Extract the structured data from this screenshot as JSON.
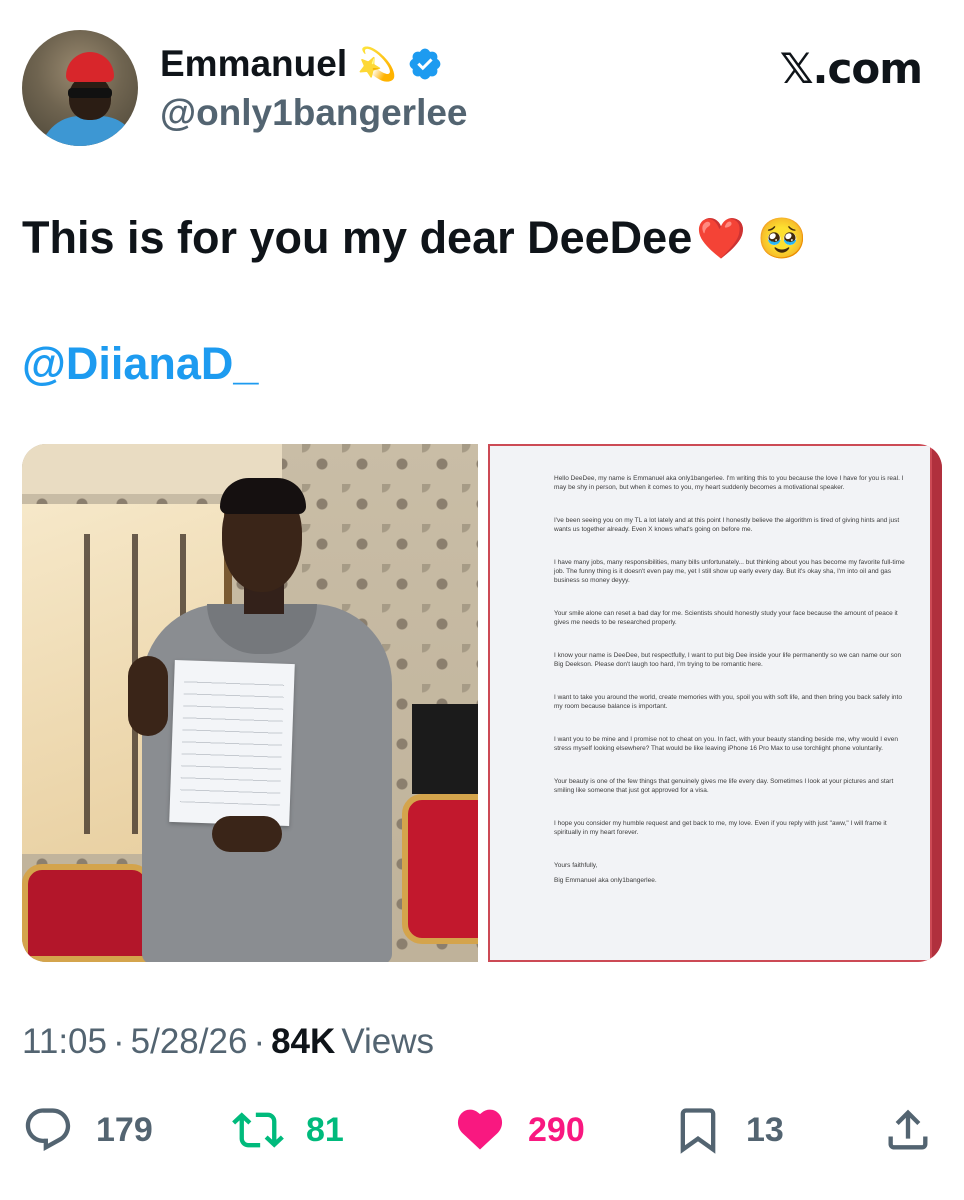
{
  "author": {
    "display_name": "Emmanuel",
    "name_emoji": "💫",
    "handle": "@only1bangerlee",
    "verified": true,
    "avatar": "user-avatar-photo"
  },
  "brand": {
    "label": "𝕏.com"
  },
  "tweet": {
    "text": "This is for you my dear DeeDee",
    "text_emojis": "❤️ 🥹",
    "mention": "@DiianaD_"
  },
  "media": {
    "photo_left": "man-holding-letter-photo",
    "letter": {
      "paragraphs": [
        "Hello DeeDee, my name is Emmanuel aka only1bangerlee. I'm writing this to you because the love I have for you is real. I may be shy in person, but when it comes to you, my heart suddenly becomes a motivational speaker.",
        "I've been seeing you on my TL a lot lately and at this point I honestly believe the algorithm is tired of giving hints and just wants us together already. Even X knows what's going on before me.",
        "I have many jobs, many responsibilities, many bills unfortunately... but thinking about you has become my favorite full-time job. The funny thing is it doesn't even pay me, yet I still show up early every day. But it's okay sha, I'm into oil and gas business so money deyyy.",
        "Your smile alone can reset a bad day for me. Scientists should honestly study your face because the amount of peace it gives me needs to be researched properly.",
        "I know your name is DeeDee, but respectfully, I want to put big Dee inside your life permanently so we can name our son Big Deekson. Please don't laugh too hard, I'm trying to be romantic here.",
        "I want to take you around the world, create memories with you, spoil you with soft life, and then bring you back safely into my room because balance is important.",
        "I want you to be mine and I promise not to cheat on you. In fact, with your beauty standing beside me, why would I even stress myself looking elsewhere? That would be like leaving iPhone 16 Pro Max to use torchlight phone voluntarily.",
        "Your beauty is one of the few things that genuinely gives me life every day. Sometimes I look at your pictures and start smiling like someone that just got approved for a visa.",
        "I hope you consider my humble request and get back to me, my love. Even if you reply with just \"aww,\" I will frame it spiritually in my heart forever."
      ],
      "closing": "Yours faithfully,",
      "signature": "Big Emmanuel aka only1bangerlee."
    }
  },
  "meta": {
    "time": "11:05",
    "sep": "·",
    "date": "5/28/26",
    "views_count": "84K",
    "views_label": "Views"
  },
  "actions": {
    "replies": "179",
    "reposts": "81",
    "likes": "290",
    "bookmarks": "13"
  },
  "colors": {
    "accent": "#1d9bf0",
    "repost": "#00ba7c",
    "like": "#f91880",
    "muted": "#536471",
    "text": "#0f1419"
  }
}
